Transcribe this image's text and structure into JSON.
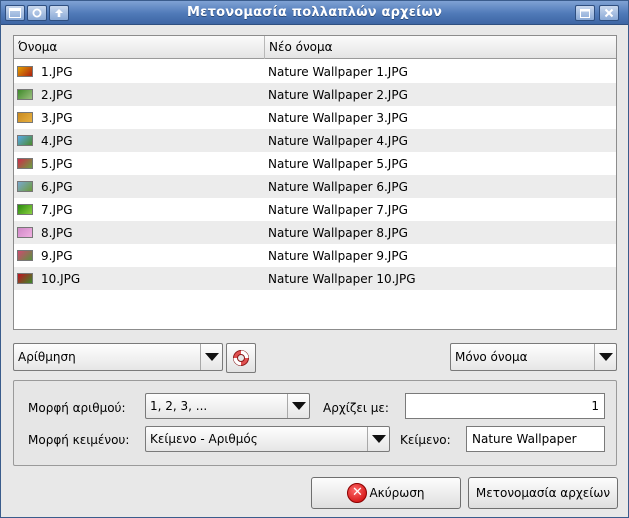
{
  "window": {
    "title": "Μετονομασία πολλαπλών αρχείων"
  },
  "list": {
    "columns": [
      "Όνομα",
      "Νέο όνομα"
    ],
    "rows": [
      {
        "name": "1.JPG",
        "new_name": "Nature Wallpaper 1.JPG",
        "thumb": [
          "#e0a000",
          "#b02010"
        ]
      },
      {
        "name": "2.JPG",
        "new_name": "Nature Wallpaper 2.JPG",
        "thumb": [
          "#3f8a2a",
          "#9cc080"
        ]
      },
      {
        "name": "3.JPG",
        "new_name": "Nature Wallpaper 3.JPG",
        "thumb": [
          "#c88a20",
          "#e8b040"
        ]
      },
      {
        "name": "4.JPG",
        "new_name": "Nature Wallpaper 4.JPG",
        "thumb": [
          "#5aa8e8",
          "#4c8a2c"
        ]
      },
      {
        "name": "5.JPG",
        "new_name": "Nature Wallpaper 5.JPG",
        "thumb": [
          "#d02a4a",
          "#6aa040"
        ]
      },
      {
        "name": "6.JPG",
        "new_name": "Nature Wallpaper 6.JPG",
        "thumb": [
          "#7aa8d0",
          "#6c9a3a"
        ]
      },
      {
        "name": "7.JPG",
        "new_name": "Nature Wallpaper 7.JPG",
        "thumb": [
          "#2a8a10",
          "#8ad040"
        ]
      },
      {
        "name": "8.JPG",
        "new_name": "Nature Wallpaper 8.JPG",
        "thumb": [
          "#d088c8",
          "#f0b0e0"
        ]
      },
      {
        "name": "9.JPG",
        "new_name": "Nature Wallpaper 9.JPG",
        "thumb": [
          "#d04a70",
          "#5a9040"
        ]
      },
      {
        "name": "10.JPG",
        "new_name": "Nature Wallpaper 10.JPG",
        "thumb": [
          "#c01020",
          "#3a8a2a"
        ]
      }
    ]
  },
  "controls": {
    "mode_select": "Αρίθμηση",
    "scope_select": "Μόνο όνομα"
  },
  "options": {
    "number_format_label": "Μορφή αριθμού:",
    "number_format_value": "1, 2, 3, ...",
    "starts_with_label": "Αρχίζει με:",
    "starts_with_value": "1",
    "text_format_label": "Μορφή κειμένου:",
    "text_format_value": "Κείμενο - Αριθμός",
    "text_label": "Κείμενο:",
    "text_value": "Nature Wallpaper"
  },
  "buttons": {
    "cancel": "Ακύρωση",
    "rename": "Μετονομασία αρχείων"
  },
  "icons": {
    "menu": "window-menu-icon",
    "up": "arrow-up-icon",
    "maximize": "maximize-icon",
    "close": "close-icon",
    "help": "lifebuoy-icon",
    "cancel": "cancel-icon"
  }
}
